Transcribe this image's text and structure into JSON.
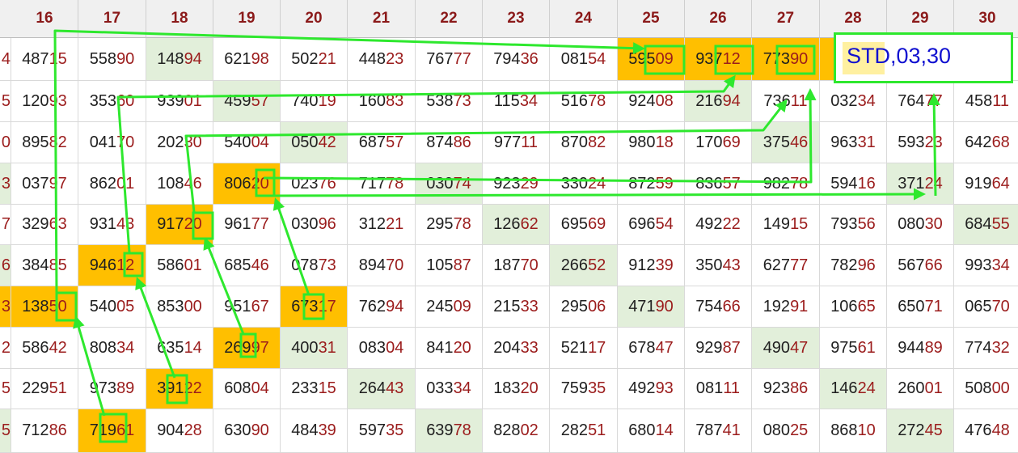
{
  "colors": {
    "orange": "#ffbf00",
    "green": "#e2efda",
    "tail": "#9b1c1c",
    "arrow": "#2ee82e",
    "std": "#1010d0"
  },
  "columns": [
    "16",
    "17",
    "18",
    "19",
    "20",
    "21",
    "22",
    "23",
    "24",
    "25",
    "26",
    "27",
    "28",
    "29",
    "30"
  ],
  "row_stubs": [
    "4",
    "5",
    "0",
    "3",
    "7",
    "6",
    "3",
    "2",
    "5",
    "5"
  ],
  "rows": [
    [
      "48715",
      "55890",
      "14894",
      "62198",
      "50221",
      "44823",
      "76777",
      "79436",
      "08154",
      "59509",
      "93712",
      "77390",
      "",
      "",
      ""
    ],
    [
      "12093",
      "35360",
      "93901",
      "45957",
      "74019",
      "16083",
      "53873",
      "11534",
      "51678",
      "92408",
      "21694",
      "73611",
      "03234",
      "76477",
      "45811"
    ],
    [
      "89582",
      "04170",
      "20230",
      "54004",
      "05042",
      "68757",
      "87486",
      "97711",
      "87082",
      "98018",
      "17069",
      "37546",
      "96331",
      "59323",
      "64268"
    ],
    [
      "03797",
      "86201",
      "10846",
      "80620",
      "02376",
      "71778",
      "03074",
      "92329",
      "33024",
      "87259",
      "83657",
      "98278",
      "59416",
      "37124",
      "91964"
    ],
    [
      "32963",
      "93143",
      "91720",
      "96177",
      "03096",
      "31221",
      "29578",
      "12662",
      "69569",
      "69654",
      "49222",
      "14915",
      "79356",
      "08030",
      "68455"
    ],
    [
      "38485",
      "94612",
      "58601",
      "68546",
      "07873",
      "89470",
      "10587",
      "18770",
      "26652",
      "91239",
      "35043",
      "62777",
      "78296",
      "56766",
      "99334"
    ],
    [
      "13850",
      "54005",
      "85300",
      "95167",
      "67317",
      "76294",
      "24509",
      "21533",
      "29506",
      "47190",
      "75466",
      "19291",
      "10665",
      "65071",
      "06570"
    ],
    [
      "58642",
      "80834",
      "63514",
      "26997",
      "40031",
      "08304",
      "84120",
      "20433",
      "52117",
      "67847",
      "92987",
      "49047",
      "97561",
      "94489",
      "77432"
    ],
    [
      "22951",
      "97389",
      "39122",
      "60804",
      "23315",
      "26443",
      "03334",
      "18320",
      "75935",
      "49293",
      "08111",
      "92386",
      "14624",
      "26001",
      "50800"
    ],
    [
      "71286",
      "71961",
      "90428",
      "63090",
      "48439",
      "59735",
      "63978",
      "82802",
      "28251",
      "68014",
      "78741",
      "08025",
      "86810",
      "27245",
      "47648"
    ]
  ],
  "highlights": {
    "orange": [
      "0-9",
      "0-10",
      "0-11",
      "0-12",
      "3-3",
      "4-2",
      "5-1",
      "6-0",
      "6-4",
      "7-3",
      "8-2",
      "9-1"
    ],
    "green": [
      "0-2",
      "1-3",
      "1-10",
      "2-4",
      "2-11",
      "3-6",
      "3-13",
      "4-7",
      "4-14",
      "5-8",
      "6-9",
      "7-4",
      "7-11",
      "8-5",
      "8-12",
      "9-6",
      "9-13"
    ],
    "stub_green": [
      3,
      5,
      9
    ],
    "stub_orange": [
      6
    ]
  },
  "std_label": "STD,03,30"
}
